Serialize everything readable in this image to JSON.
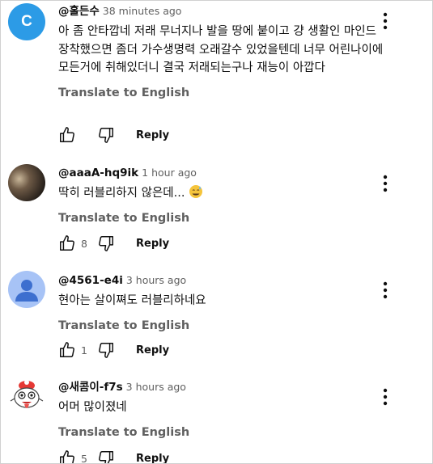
{
  "translate_label": "Translate to English",
  "reply_label": "Reply",
  "comments": [
    {
      "handle": "@홀든수",
      "time": "38 minutes ago",
      "avatar": {
        "type": "letter",
        "letter": "C",
        "color": "#2c9be6"
      },
      "text": "아 좀 안타깝네 저래 무너지나 발을 땅에 붙이고 걍 생활인 마인드 장착했으면 좀더 가수생명력 오래갈수 있었을텐데 너무 어린나이에 모든거에 취해있더니 결국 저래되는구나 재능이 아깝다",
      "likes": ""
    },
    {
      "handle": "@aaaA-hq9ik",
      "time": "1 hour ago",
      "avatar": {
        "type": "photo"
      },
      "text": "딱히 러블리하지 않은데...",
      "emoji": "sweat-smile-emoji",
      "likes": "8"
    },
    {
      "handle": "@4561-e4i",
      "time": "3 hours ago",
      "avatar": {
        "type": "default-person",
        "color": "#a7c3f6"
      },
      "text": "현아는 살이쪄도 러블리하네요",
      "likes": "1"
    },
    {
      "handle": "@새콤이-f7s",
      "time": "3 hours ago",
      "avatar": {
        "type": "cartoon"
      },
      "text": "어머 많이졌네",
      "likes": "5"
    }
  ]
}
